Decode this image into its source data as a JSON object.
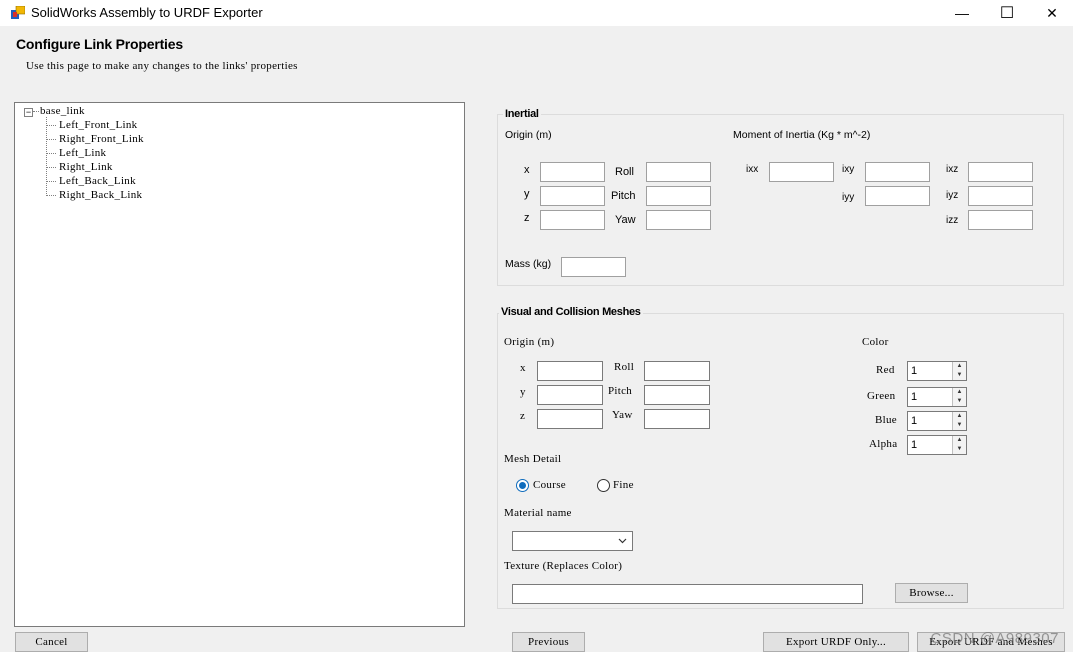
{
  "window": {
    "title": "SolidWorks Assembly to URDF Exporter",
    "minimize_glyph": "—",
    "maximize_glyph": "☐",
    "close_glyph": "✕"
  },
  "page": {
    "heading": "Configure Link Properties",
    "subtitle": "Use this page to make any changes to the links' properties"
  },
  "tree": {
    "expander": "−",
    "root": "base_link",
    "children": [
      "Left_Front_Link",
      "Right_Front_Link",
      "Left_Link",
      "Right_Link",
      "Left_Back_Link",
      "Right_Back_Link"
    ]
  },
  "inertial": {
    "title": "Inertial",
    "origin_label": "Origin (m)",
    "moment_label": "Moment of Inertia (Kg * m^-2)",
    "x": "x",
    "y": "y",
    "z": "z",
    "roll": "Roll",
    "pitch": "Pitch",
    "yaw": "Yaw",
    "ixx": "ixx",
    "ixy": "ixy",
    "ixz": "ixz",
    "iyy": "iyy",
    "iyz": "iyz",
    "izz": "izz",
    "mass_label": "Mass (kg)"
  },
  "visual": {
    "title": "Visual and Collision Meshes",
    "origin_label": "Origin (m)",
    "x": "x",
    "y": "y",
    "z": "z",
    "roll": "Roll",
    "pitch": "Pitch",
    "yaw": "Yaw",
    "color_label": "Color",
    "red": "Red",
    "green": "Green",
    "blue": "Blue",
    "alpha": "Alpha",
    "red_value": "1",
    "green_value": "1",
    "blue_value": "1",
    "alpha_value": "1",
    "mesh_detail_label": "Mesh Detail",
    "course": "Course",
    "fine": "Fine",
    "mesh_detail_selected": "Course",
    "material_label": "Material name",
    "material_value": "",
    "texture_label": "Texture (Replaces Color)",
    "texture_value": "",
    "browse": "Browse..."
  },
  "footer": {
    "cancel": "Cancel",
    "previous": "Previous",
    "export_urdf": "Export URDF Only...",
    "export_all": "Export URDF and Meshes"
  },
  "watermark": "CSDN @A989307"
}
